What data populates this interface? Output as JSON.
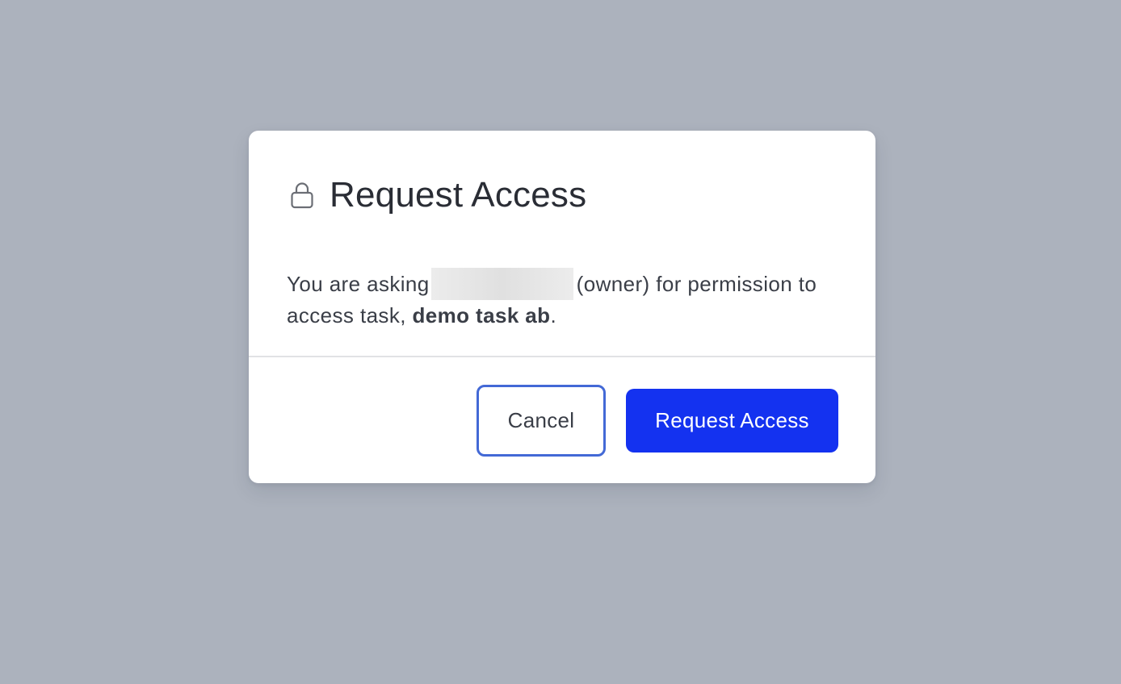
{
  "colors": {
    "backdrop": "#acb2bd",
    "title_text": "#2a2d35",
    "body_text": "#3a3e47",
    "lock_icon": "#6b6e75",
    "divider": "#e1e2e5",
    "cancel_border": "#4369d6",
    "cancel_text": "#3a3e47",
    "primary_bg": "#1432f0",
    "primary_text": "#ffffff"
  },
  "dialog": {
    "icon": "lock-icon",
    "title": "Request Access",
    "body": {
      "prefix": "You are asking",
      "owner_suffix": "(owner) for permission to access task, ",
      "task_name": "demo task ab",
      "suffix": "."
    },
    "buttons": {
      "cancel_label": "Cancel",
      "request_label": "Request Access"
    }
  }
}
